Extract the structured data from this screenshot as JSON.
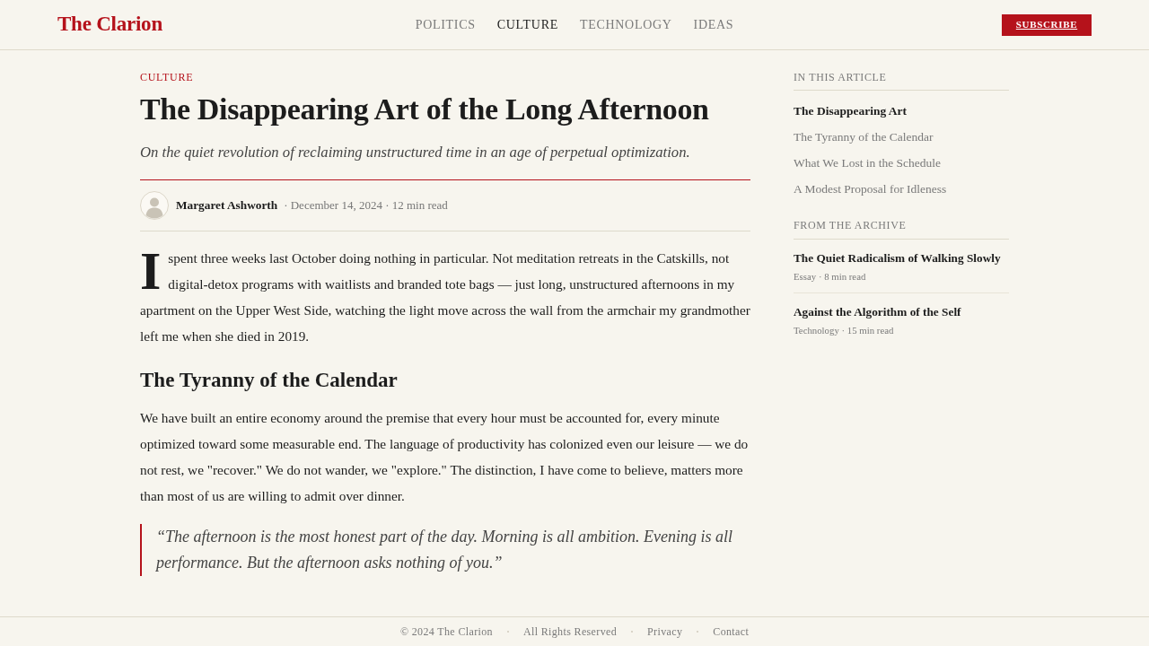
{
  "header": {
    "logo": "The Clarion",
    "nav": [
      {
        "label": "POLITICS",
        "selected": false
      },
      {
        "label": "CULTURE",
        "selected": true
      },
      {
        "label": "TECHNOLOGY",
        "selected": false
      },
      {
        "label": "IDEAS",
        "selected": false
      }
    ],
    "subscribe_button": "SUBSCRIBE"
  },
  "article": {
    "category": "CULTURE",
    "title": "The Disappearing Art of the Long Afternoon",
    "subtitle": "On the quiet revolution of reclaiming unstructured time in an age of perpetual optimization.",
    "byline": {
      "author": "Margaret Ashworth",
      "meta": "· December 14, 2024 · 12 min read"
    },
    "body": [
      {
        "kind": "paragraph",
        "drop_cap": true,
        "text": "I spent three weeks last October doing nothing in particular. Not meditation retreats in the Catskills, not digital-detox programs with waitlists and branded tote bags — just long, unstructured afternoons in my apartment on the Upper West Side, watching the light move across the wall from the armchair my grandmother left me when she died in 2019."
      },
      {
        "kind": "heading",
        "text": "The Tyranny of the Calendar"
      },
      {
        "kind": "paragraph",
        "drop_cap": false,
        "text": "We have built an entire economy around the premise that every hour must be accounted for, every minute optimized toward some measurable end. The language of productivity has colonized even our leisure — we do not rest, we \"recover.\" We do not wander, we \"explore.\" The distinction, I have come to believe, matters more than most of us are willing to admit over dinner."
      },
      {
        "kind": "quote",
        "text": "“The afternoon is the most honest part of the day. Morning is all ambition. Evening is all performance. But the afternoon asks nothing of you.”"
      }
    ]
  },
  "sidebar": {
    "toc": {
      "title": "IN THIS ARTICLE",
      "items": [
        {
          "label": "The Disappearing Art",
          "selected": true
        },
        {
          "label": "The Tyranny of the Calendar",
          "selected": false
        },
        {
          "label": "What We Lost in the Schedule",
          "selected": false
        },
        {
          "label": "A Modest Proposal for Idleness",
          "selected": false
        }
      ]
    },
    "archive": {
      "title": "FROM THE ARCHIVE",
      "items": [
        {
          "title": "The Quiet Radicalism of Walking Slowly",
          "meta": "Essay · 8 min read"
        },
        {
          "title": "Against the Algorithm of the Self",
          "meta": "Technology · 15 min read"
        }
      ]
    }
  },
  "footer": {
    "items": [
      "© 2024 The Clarion",
      "All Rights Reserved",
      "Privacy",
      "Contact"
    ]
  }
}
